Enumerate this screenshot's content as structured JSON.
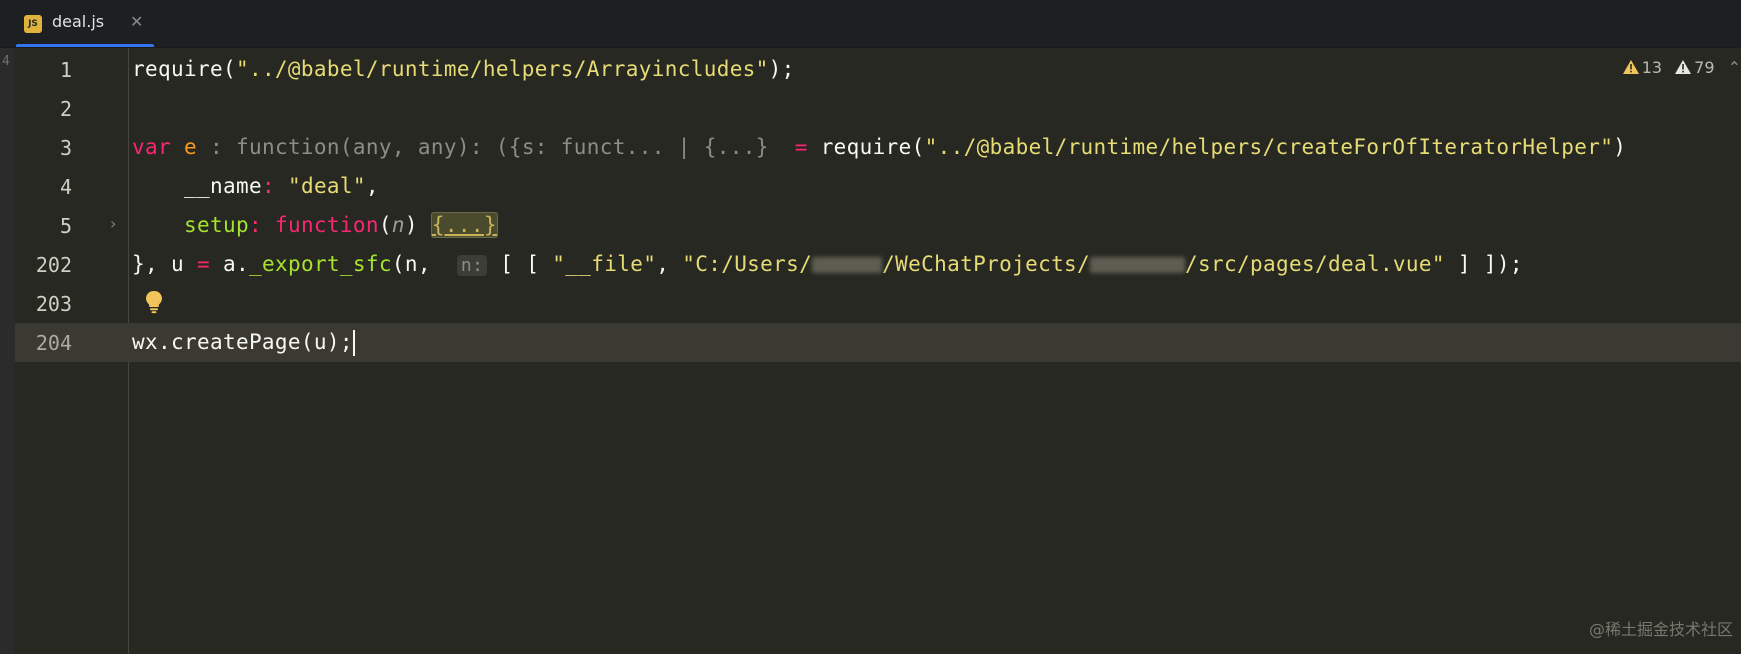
{
  "tab": {
    "icon": "javascript-file-icon",
    "icon_text": "JS",
    "title": "deal.js",
    "close": "✕"
  },
  "left_strip_fragment": "4",
  "warnings": {
    "warning_count": "13",
    "weak_warning_count": "79"
  },
  "lines": {
    "l1": {
      "num": "1",
      "require": "require(",
      "path": "\"../@babel/runtime/helpers/Arrayincludes\"",
      "end": ");"
    },
    "l2": {
      "num": "2"
    },
    "l3": {
      "num": "3",
      "kw": "var",
      "name": "e",
      "type_hint": ": function(any, any): ({s: funct... | {...}",
      "eq": "=",
      "require": "require(",
      "path": "\"../@babel/runtime/helpers/createForOfIteratorHelper\"",
      "end": ")"
    },
    "l4": {
      "num": "4",
      "key": "__name",
      "colon": ":",
      "value": "\"deal\"",
      "comma": ","
    },
    "l5": {
      "num": "5",
      "key": "setup",
      "colon": ":",
      "kw": "function",
      "open": "(",
      "param": "n",
      "close": ")",
      "folded": "{...}"
    },
    "l202": {
      "num": "202",
      "start": "}, u",
      "eq": "=",
      "mid": "a.",
      "fn": "_export_sfc",
      "args": "(n,",
      "hint": "n:",
      "arr_open": "[ [",
      "file_key": "\"__file\"",
      "comma": ",",
      "path_a": "\"C:/Users/",
      "path_b": "/WeChatProjects/",
      "path_c": "/src/pages/deal.vue\"",
      "arr_close": "] ]);"
    },
    "l203": {
      "num": "203"
    },
    "l204": {
      "num": "204",
      "code": "wx.createPage(u);"
    }
  },
  "watermark": "@稀土掘金技术社区",
  "colors": {
    "background": "#272822",
    "current_line": "#3b3a32",
    "string": "#e6db74",
    "keyword": "#f92672",
    "variable": "#fd971f",
    "function": "#a6e22e",
    "tab_accent": "#3574f0"
  }
}
